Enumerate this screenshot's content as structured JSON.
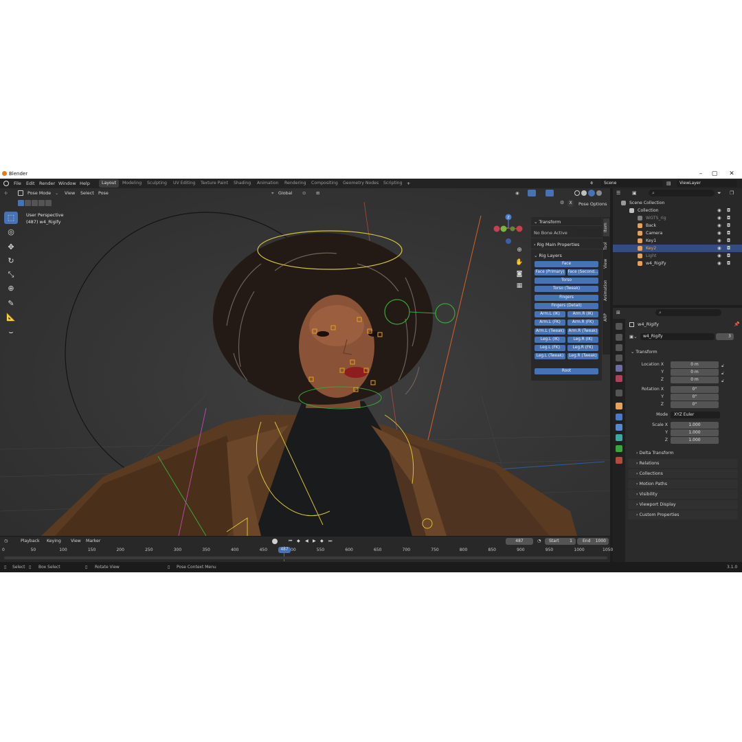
{
  "window": {
    "title": "Blender",
    "controls": [
      "–",
      "▢",
      "✕"
    ]
  },
  "menu": {
    "items": [
      "File",
      "Edit",
      "Render",
      "Window",
      "Help"
    ],
    "workspaces": [
      "Layout",
      "Modeling",
      "Sculpting",
      "UV Editing",
      "Texture Paint",
      "Shading",
      "Animation",
      "Rendering",
      "Compositing",
      "Geometry Nodes",
      "Scripting"
    ],
    "add_workspace": "+",
    "scene_label": "Scene",
    "viewlayer_label": "ViewLayer"
  },
  "viewport": {
    "mode": "Pose Mode",
    "menus": [
      "View",
      "Select",
      "Pose"
    ],
    "orientation": "Global",
    "pose_options": "Pose Options",
    "perspective": "User Perspective",
    "object_line": "(487) w4_Rigify"
  },
  "n_panel": {
    "tabs": [
      "Item",
      "Tool",
      "View",
      "Animation",
      "ARP"
    ],
    "transform_header": "Transform",
    "no_bone": "No Bone Active",
    "rig_main_header": "Rig Main Properties",
    "rig_layers_header": "Rig Layers",
    "layers": {
      "face": "Face",
      "face_primary": "Face (Primary)",
      "face_secondary": "Face (Second...",
      "torso": "Torso",
      "torso_tweak": "Torso (Tweak)",
      "fingers": "Fingers",
      "fingers_detail": "Fingers (Detail)",
      "arm_l_ik": "Arm.L (IK)",
      "arm_r_ik": "Arm.R (IK)",
      "arm_l_fk": "Arm.L (FK)",
      "arm_r_fk": "Arm.R (FK)",
      "arm_l_tweak": "Arm.L (Tweak)",
      "arm_r_tweak": "Arm.R (Tweak)",
      "leg_l_ik": "Leg.L (IK)",
      "leg_r_ik": "Leg.R (IK)",
      "leg_l_fk": "Leg.L (FK)",
      "leg_r_fk": "Leg.R (FK)",
      "leg_l_tweak": "Leg.L (Tweak)",
      "leg_r_tweak": "Leg.R (Tweak)",
      "root": "Root"
    }
  },
  "timeline": {
    "menus": [
      "Playback",
      "Keying",
      "View",
      "Marker"
    ],
    "current_frame": "487",
    "start_label": "Start",
    "start": "1",
    "end_label": "End",
    "end": "1000",
    "ticks": [
      "0",
      "50",
      "100",
      "150",
      "200",
      "250",
      "300",
      "350",
      "400",
      "450",
      "500",
      "550",
      "600",
      "650",
      "700",
      "750",
      "800",
      "850",
      "900",
      "950",
      "1000",
      "1050"
    ],
    "playhead": "487"
  },
  "status": {
    "select": "Select",
    "box_select": "Box Select",
    "rotate_view": "Rotate View",
    "pose_context": "Pose Context Menu",
    "version": "3.1.0"
  },
  "outliner": {
    "rows": [
      {
        "name": "Scene Collection",
        "indent": 0,
        "color": "#9a9a9a"
      },
      {
        "name": "Collection",
        "indent": 1,
        "color": "#c0c0c0"
      },
      {
        "name": "WGTS_rig",
        "indent": 2,
        "color": "#7d7d7d"
      },
      {
        "name": "Back",
        "indent": 2,
        "color": "#e7a15c"
      },
      {
        "name": "Camera",
        "indent": 2,
        "color": "#e7a15c"
      },
      {
        "name": "Key1",
        "indent": 2,
        "color": "#e7a15c"
      },
      {
        "name": "Key2",
        "indent": 2,
        "color": "#e7a15c"
      },
      {
        "name": "Light",
        "indent": 2,
        "color": "#e7a15c"
      },
      {
        "name": "w4_Rigify",
        "indent": 2,
        "color": "#e7a15c"
      }
    ],
    "selected_row": "Key2"
  },
  "properties": {
    "object_name": "w4_Rigify",
    "data_name": "w4_Rigify",
    "users": "3",
    "transform_header": "Transform",
    "location_labels": [
      "Location X",
      "Y",
      "Z"
    ],
    "location_values": [
      "0 m",
      "0 m",
      "0 m"
    ],
    "rotation_labels": [
      "Rotation X",
      "Y",
      "Z"
    ],
    "rotation_values": [
      "0°",
      "0°",
      "0°"
    ],
    "mode_label": "Mode",
    "mode_value": "XYZ Euler",
    "scale_labels": [
      "Scale X",
      "Y",
      "Z"
    ],
    "scale_values": [
      "1.000",
      "1.000",
      "1.000"
    ],
    "delta_transform": "Delta Transform",
    "sections": [
      "Relations",
      "Collections",
      "Motion Paths",
      "Visibility",
      "Viewport Display",
      "Custom Properties"
    ]
  },
  "colors": {
    "accent": "#4772b3",
    "bg_dark": "#1d1d1d",
    "panel": "#2b2b2b",
    "selected": "#334d80"
  }
}
